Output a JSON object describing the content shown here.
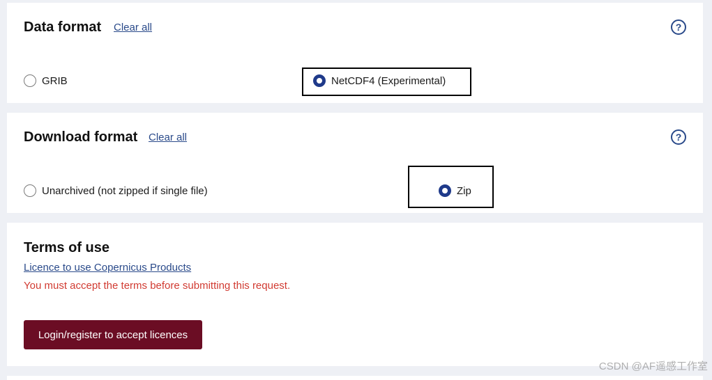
{
  "data_format": {
    "title": "Data format",
    "clear_label": "Clear all",
    "help_glyph": "?",
    "options": [
      {
        "label": "GRIB",
        "checked": false
      },
      {
        "label": "NetCDF4 (Experimental)",
        "checked": true
      }
    ]
  },
  "download_format": {
    "title": "Download format",
    "clear_label": "Clear all",
    "help_glyph": "?",
    "options": [
      {
        "label": "Unarchived (not zipped if single file)",
        "checked": false
      },
      {
        "label": "Zip",
        "checked": true
      }
    ]
  },
  "terms": {
    "title": "Terms of use",
    "licence_link": "Licence to use Copernicus Products",
    "error_message": "You must accept the terms before submitting this request.",
    "login_button": "Login/register to accept licences"
  },
  "watermark": "CSDN @AF遥感工作室",
  "colors": {
    "accent": "#1f3a8a",
    "link": "#2a4a8a",
    "error": "#d13b32",
    "button": "#6b0d24",
    "background": "#eef0f5"
  }
}
